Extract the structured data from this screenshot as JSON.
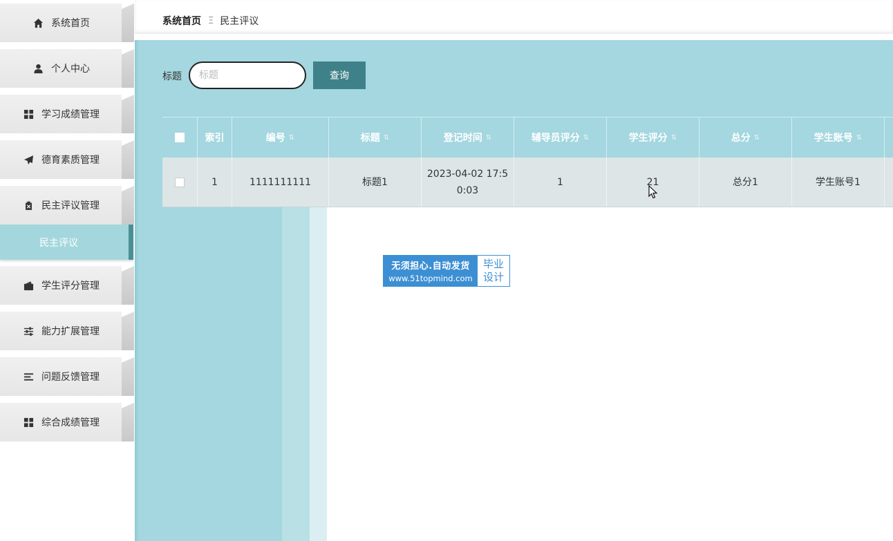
{
  "sidebar": {
    "items": [
      {
        "label": "系统首页",
        "icon": "home-icon"
      },
      {
        "label": "个人中心",
        "icon": "user-icon"
      },
      {
        "label": "学习成绩管理",
        "icon": "grid-icon"
      },
      {
        "label": "德育素质管理",
        "icon": "send-icon"
      },
      {
        "label": "民主评议管理",
        "icon": "clipboard-icon"
      },
      {
        "label": "学生评分管理",
        "icon": "wallet-icon"
      },
      {
        "label": "能力扩展管理",
        "icon": "sliders-icon"
      },
      {
        "label": "问题反馈管理",
        "icon": "list-icon"
      },
      {
        "label": "综合成绩管理",
        "icon": "grid-icon"
      }
    ],
    "active_sub_item": "民主评议"
  },
  "breadcrumb": {
    "home": "系统首页",
    "separator": "Ξ",
    "current": "民主评议"
  },
  "search": {
    "label": "标题",
    "placeholder": "标题",
    "value": "",
    "button_label": "查询"
  },
  "table": {
    "columns": [
      {
        "label": "",
        "type": "checkbox"
      },
      {
        "label": "索引",
        "sortable": false
      },
      {
        "label": "编号",
        "sortable": true
      },
      {
        "label": "标题",
        "sortable": true
      },
      {
        "label": "登记时间",
        "sortable": true
      },
      {
        "label": "辅导员评分",
        "sortable": true
      },
      {
        "label": "学生评分",
        "sortable": true
      },
      {
        "label": "总分",
        "sortable": true
      },
      {
        "label": "学生账号",
        "sortable": true
      }
    ],
    "sort_glyph": "⇅",
    "rows": [
      {
        "index": "1",
        "number": "1111111111",
        "title": "标题1",
        "time_line1": "2023-04-02 17:5",
        "time_line2": "0:03",
        "counselor_score": "1",
        "student_score": "21",
        "total": "总分1",
        "student_account": "学生账号1"
      }
    ]
  },
  "watermark": {
    "line1": "无须担心.自动发货",
    "line2": "www.51topmind.com",
    "right_line1": "毕业",
    "right_line2": "设计"
  },
  "colors": {
    "accent": "#a4d7df",
    "button": "#3f8188",
    "active_border": "#4a8f94",
    "watermark_blue": "#3c8fd3"
  }
}
